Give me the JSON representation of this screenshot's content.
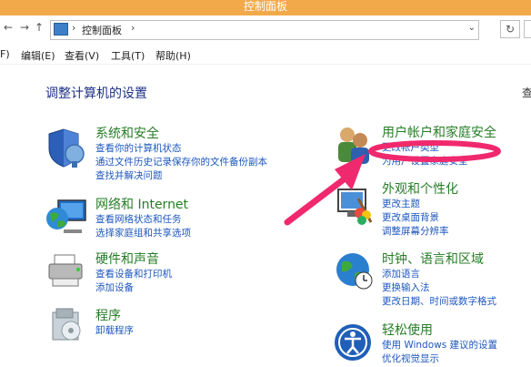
{
  "window": {
    "title": "控制面板"
  },
  "navigation": {
    "back_glyph": "←",
    "forward_glyph": "→",
    "up_glyph": "↑",
    "refresh_glyph": "↻"
  },
  "address_bar": {
    "separator": "›",
    "crumb": "控制面板",
    "separator2": "›",
    "dropdown_glyph": "⌄"
  },
  "menu": {
    "items": [
      "F)",
      "编辑(E)",
      "查看(V)",
      "工具(T)",
      "帮助(H)"
    ]
  },
  "main": {
    "heading": "调整计算机的设置",
    "view_label": "查"
  },
  "categories": {
    "security": {
      "title": "系统和安全",
      "links": [
        "查看你的计算机状态",
        "通过文件历史记录保存你的文件备份副本",
        "查找并解决问题"
      ]
    },
    "network": {
      "title": "网络和 Internet",
      "links": [
        "查看网络状态和任务",
        "选择家庭组和共享选项"
      ]
    },
    "hardware": {
      "title": "硬件和声音",
      "links": [
        "查看设备和打印机",
        "添加设备"
      ]
    },
    "programs": {
      "title": "程序",
      "links": [
        "卸载程序"
      ]
    },
    "users": {
      "title": "用户帐户和家庭安全",
      "links": [
        "更改帐户类型",
        "为用户设置家庭安全"
      ]
    },
    "appearance": {
      "title": "外观和个性化",
      "links": [
        "更改主题",
        "更改桌面背景",
        "调整屏幕分辨率"
      ]
    },
    "clock": {
      "title": "时钟、语言和区域",
      "links": [
        "添加语言",
        "更换输入法",
        "更改日期、时间或数字格式"
      ]
    },
    "ease": {
      "title": "轻松使用",
      "links": [
        "使用 Windows 建议的设置",
        "优化视觉显示"
      ]
    }
  },
  "colors": {
    "titlebar": "#f2a94a",
    "heading": "#1e3287",
    "category_title": "#267d26",
    "link": "#1d57bd",
    "annotation": "#f0296e"
  }
}
